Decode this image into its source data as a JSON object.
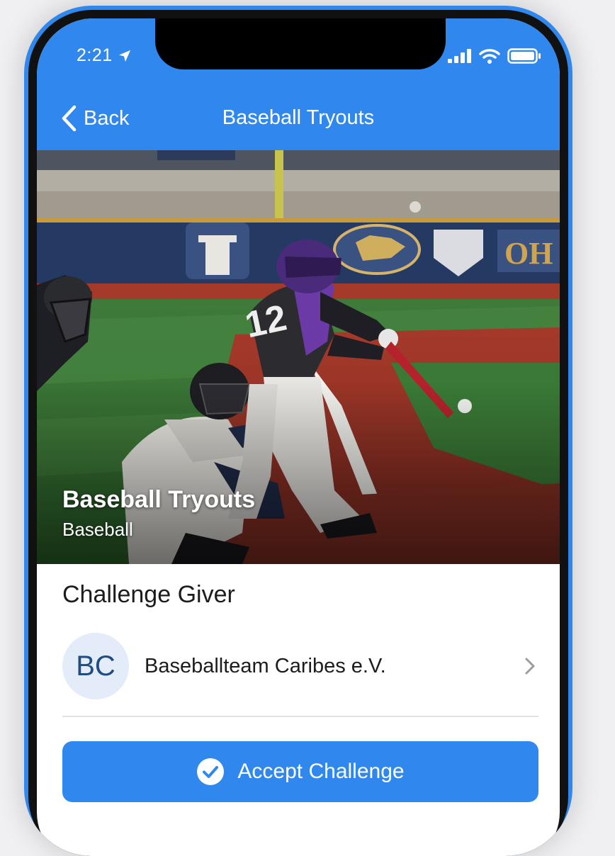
{
  "status_bar": {
    "time": "2:21"
  },
  "navbar": {
    "back_label": "Back",
    "title": "Baseball Tryouts"
  },
  "hero": {
    "title": "Baseball Tryouts",
    "subtitle": "Baseball"
  },
  "challenge_giver": {
    "heading": "Challenge Giver",
    "initials": "BC",
    "name": "Baseballteam Caribes e.V."
  },
  "accept_button": {
    "label": "Accept Challenge"
  },
  "colors": {
    "accent": "#3088ee",
    "avatar_bg": "#e3ecf8",
    "avatar_text": "#1f4c82"
  },
  "icons": [
    "location-arrow-icon",
    "signal-icon",
    "wifi-icon",
    "battery-icon",
    "chevron-left-icon",
    "chevron-right-icon",
    "checkmark-circle-icon"
  ]
}
